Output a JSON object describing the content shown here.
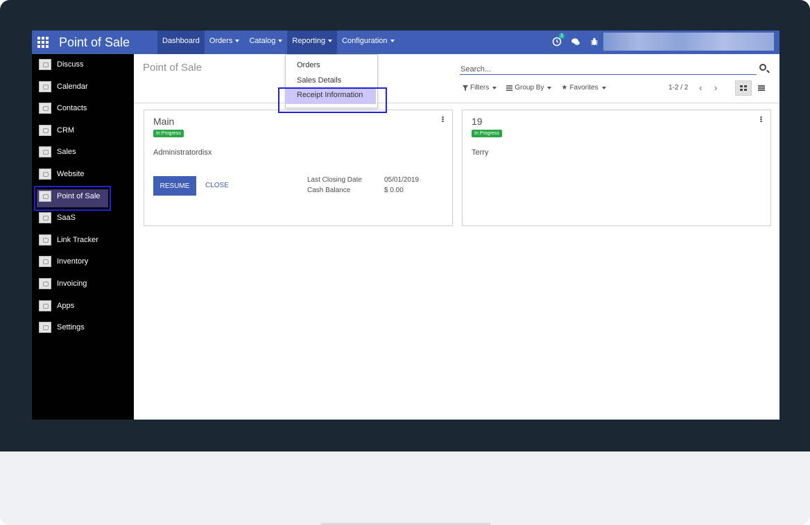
{
  "app": {
    "title": "Point of Sale"
  },
  "nav": {
    "items": [
      {
        "label": "Dashboard",
        "has_caret": false
      },
      {
        "label": "Orders",
        "has_caret": true
      },
      {
        "label": "Catalog",
        "has_caret": true
      },
      {
        "label": "Reporting",
        "has_caret": true
      },
      {
        "label": "Configuration",
        "has_caret": true
      }
    ],
    "activity_count": "1"
  },
  "reporting_menu": {
    "items": [
      "Orders",
      "Sales Details",
      "Receipt Information"
    ]
  },
  "sidebar": {
    "items": [
      {
        "label": "Discuss"
      },
      {
        "label": "Calendar"
      },
      {
        "label": "Contacts"
      },
      {
        "label": "CRM"
      },
      {
        "label": "Sales"
      },
      {
        "label": "Website"
      },
      {
        "label": "Point of Sale"
      },
      {
        "label": "SaaS"
      },
      {
        "label": "Link Tracker"
      },
      {
        "label": "Inventory"
      },
      {
        "label": "Invoicing"
      },
      {
        "label": "Apps"
      },
      {
        "label": "Settings"
      }
    ]
  },
  "control_panel": {
    "breadcrumb": "Point of Sale",
    "search_placeholder": "Search...",
    "filters_label": "Filters",
    "groupby_label": "Group By",
    "favorites_label": "Favorites",
    "pager": "1-2 / 2"
  },
  "sessions": [
    {
      "title": "Main",
      "status": "In Progress",
      "user": "Administratordisx",
      "resume_label": "RESUME",
      "close_label": "CLOSE",
      "closing_date_label": "Last Closing Date",
      "closing_date": "05/01/2019",
      "cash_balance_label": "Cash Balance",
      "cash_balance": "$ 0.00"
    },
    {
      "title": "19",
      "status": "In Progress",
      "user": "Terry"
    }
  ],
  "colors": {
    "navbar": "#3e5fb5",
    "highlight_border": "#1e22d8",
    "status_green": "#28a745"
  }
}
